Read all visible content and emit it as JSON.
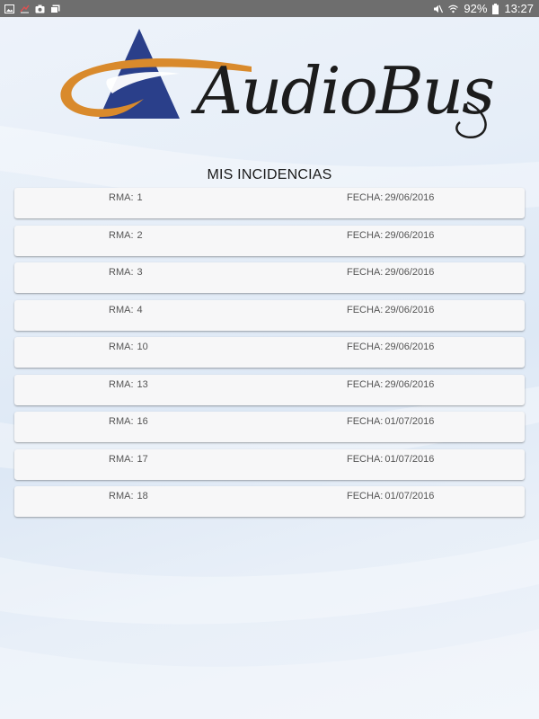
{
  "status_bar": {
    "battery": "92%",
    "time": "13:27",
    "icons_left": [
      "gallery-icon",
      "missed-call-icon",
      "camera-icon",
      "photos-icon"
    ],
    "icons_right": [
      "mute-icon",
      "wifi-icon",
      "battery-icon"
    ]
  },
  "logo": {
    "text": "AudioBus",
    "colors": {
      "triangle": "#2a3f8a",
      "swoosh": "#d98a2c",
      "text": "#1c1c1c"
    }
  },
  "page": {
    "title": "MIS INCIDENCIAS"
  },
  "incidencias": [
    {
      "rma_label": "RMA:",
      "rma": "1",
      "fecha_label": "FECHA:",
      "fecha": "29/06/2016"
    },
    {
      "rma_label": "RMA:",
      "rma": "2",
      "fecha_label": "FECHA:",
      "fecha": "29/06/2016"
    },
    {
      "rma_label": "RMA:",
      "rma": "3",
      "fecha_label": "FECHA:",
      "fecha": "29/06/2016"
    },
    {
      "rma_label": "RMA:",
      "rma": "4",
      "fecha_label": "FECHA:",
      "fecha": "29/06/2016"
    },
    {
      "rma_label": "RMA:",
      "rma": "10",
      "fecha_label": "FECHA:",
      "fecha": "29/06/2016"
    },
    {
      "rma_label": "RMA:",
      "rma": "13",
      "fecha_label": "FECHA:",
      "fecha": "29/06/2016"
    },
    {
      "rma_label": "RMA:",
      "rma": "16",
      "fecha_label": "FECHA:",
      "fecha": "01/07/2016"
    },
    {
      "rma_label": "RMA:",
      "rma": "17",
      "fecha_label": "FECHA:",
      "fecha": "01/07/2016"
    },
    {
      "rma_label": "RMA:",
      "rma": "18",
      "fecha_label": "FECHA:",
      "fecha": "01/07/2016"
    }
  ]
}
